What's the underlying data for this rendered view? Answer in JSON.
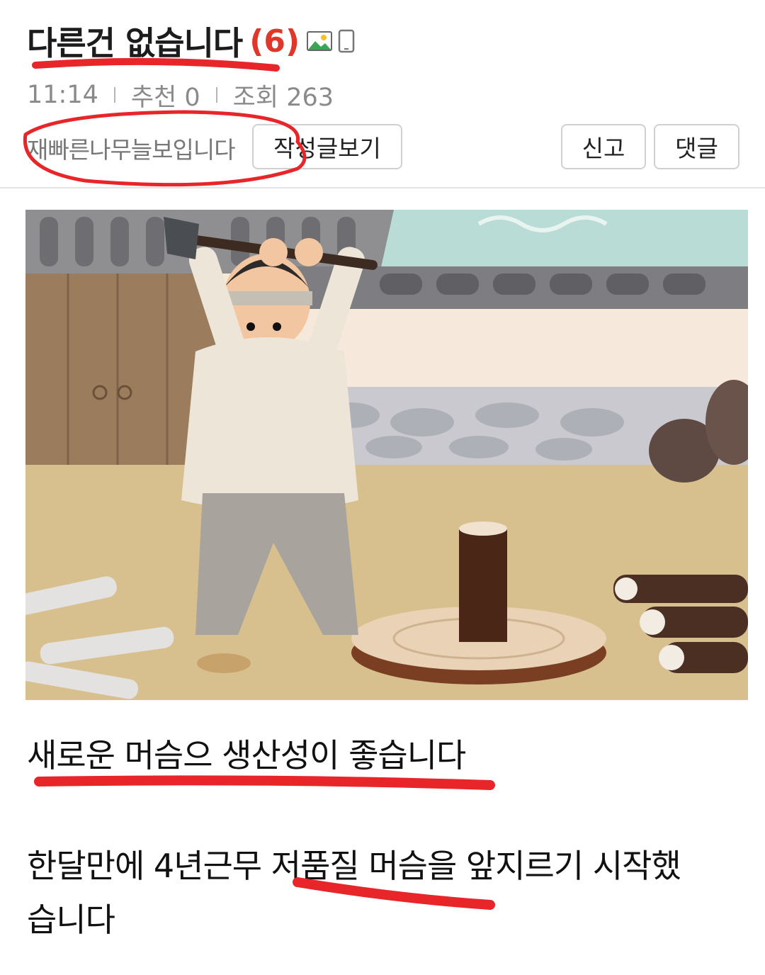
{
  "post": {
    "title": "다른건 없습니다",
    "comment_count": "(6)",
    "title_icons": [
      "image-icon",
      "mobile-icon"
    ],
    "time": "11:14",
    "recommend": "추천 0",
    "views": "조회 263",
    "author": "재빠른나무늘보입니다",
    "author_posts_button": "작성글보기",
    "report_button": "신고",
    "comment_button": "댓글"
  },
  "content": {
    "line1": "새로운 머슴으 생산성이 좋습니다",
    "line2": "한달만에 4년근무  저품질 머슴을 앞지르기 시작했",
    "line3": "습니다"
  },
  "colors": {
    "comment_count": "#e0372b",
    "annotation_red": "#e8262a",
    "meta_gray": "#8a8a8a"
  }
}
